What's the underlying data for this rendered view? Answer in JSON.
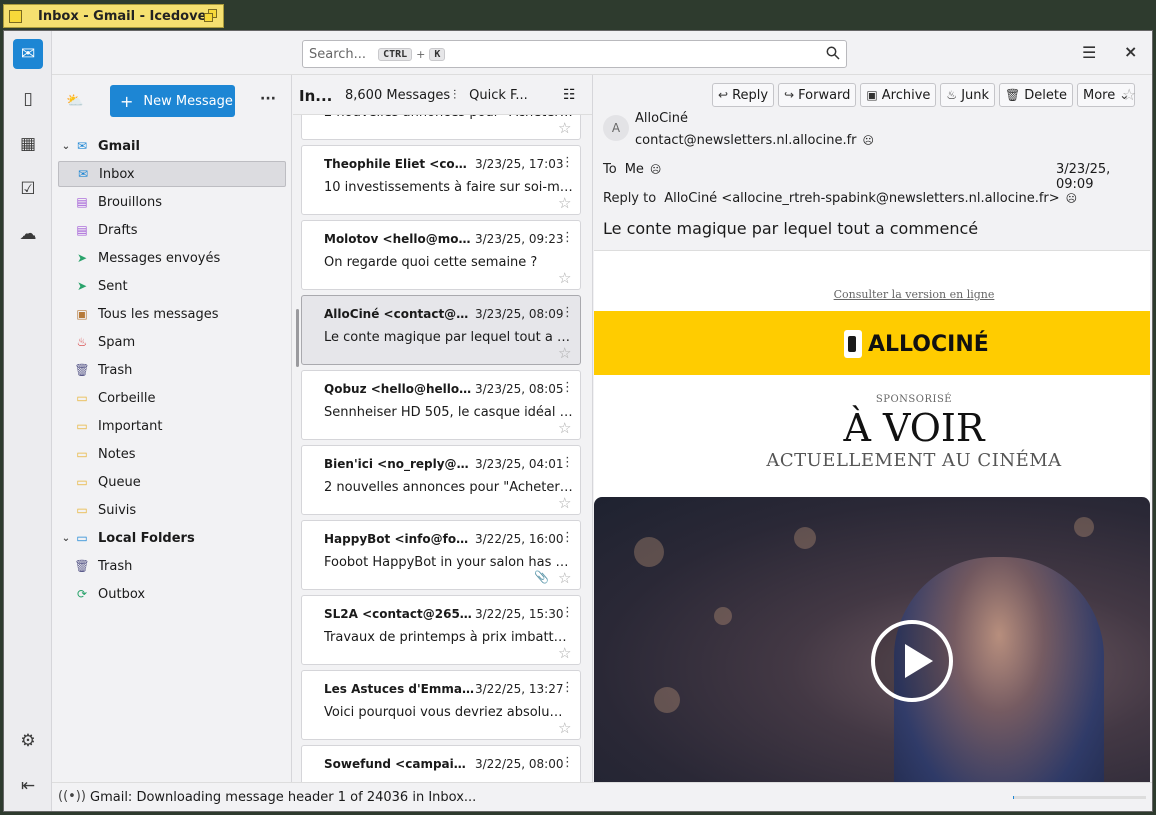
{
  "window": {
    "title": "Inbox - Gmail - Icedove"
  },
  "spaces": [
    {
      "name": "mail-icon",
      "glyph": "✉"
    },
    {
      "name": "address-book-icon",
      "glyph": "▯"
    },
    {
      "name": "calendar-icon",
      "glyph": "▦"
    },
    {
      "name": "tasks-icon",
      "glyph": "☑"
    },
    {
      "name": "chat-icon",
      "glyph": "☁"
    }
  ],
  "search": {
    "placeholder": "Search...",
    "shortcut_key1": "CTRL",
    "shortcut_plus": "+",
    "shortcut_key2": "K"
  },
  "folder_pane": {
    "new_message": "New Message",
    "accounts": [
      {
        "label": "Gmail"
      },
      {
        "label": "Local Folders"
      }
    ],
    "gmail_folders": [
      {
        "label": "Inbox",
        "icon": "inbox-icon",
        "glyph": "✉",
        "color": "#1d86d4"
      },
      {
        "label": "Brouillons",
        "icon": "draft-icon",
        "glyph": "▤",
        "color": "#a25ad6"
      },
      {
        "label": "Drafts",
        "icon": "draft-icon",
        "glyph": "▤",
        "color": "#a25ad6"
      },
      {
        "label": "Messages envoyés",
        "icon": "sent-icon",
        "glyph": "➤",
        "color": "#2aa36b"
      },
      {
        "label": "Sent",
        "icon": "sent-icon",
        "glyph": "➤",
        "color": "#2aa36b"
      },
      {
        "label": "Tous les messages",
        "icon": "archive-icon",
        "glyph": "▣",
        "color": "#b67a3a"
      },
      {
        "label": "Spam",
        "icon": "spam-icon",
        "glyph": "♨",
        "color": "#d63a3a"
      },
      {
        "label": "Trash",
        "icon": "trash-icon",
        "glyph": "🗑",
        "color": "#5a5a8a"
      },
      {
        "label": "Corbeille",
        "icon": "folder-icon",
        "glyph": "▭",
        "color": "#e8b53a"
      },
      {
        "label": "Important",
        "icon": "folder-icon",
        "glyph": "▭",
        "color": "#e8b53a"
      },
      {
        "label": "Notes",
        "icon": "folder-icon",
        "glyph": "▭",
        "color": "#e8b53a"
      },
      {
        "label": "Queue",
        "icon": "folder-icon",
        "glyph": "▭",
        "color": "#e8b53a"
      },
      {
        "label": "Suivis",
        "icon": "folder-icon",
        "glyph": "▭",
        "color": "#e8b53a"
      }
    ],
    "local_folders": [
      {
        "label": "Trash",
        "icon": "trash-icon",
        "glyph": "🗑",
        "color": "#5a5a8a"
      },
      {
        "label": "Outbox",
        "icon": "outbox-icon",
        "glyph": "⟳",
        "color": "#2aa36b"
      }
    ]
  },
  "message_list": {
    "folder_title": "In...",
    "count": "8,600 Messages",
    "quick_filter": "Quick F...",
    "messages": [
      {
        "sender": "",
        "date": "",
        "subject": "2 nouvelles annonces pour \"Acheter une...",
        "attachment": false,
        "selected": false
      },
      {
        "sender": "Theophile Eliet <conta...",
        "date": "3/23/25, 17:03",
        "subject": "10 investissements à faire sur soi-même ...",
        "attachment": false,
        "selected": false
      },
      {
        "sender": "Molotov <hello@molot...",
        "date": "3/23/25, 09:23",
        "subject": "On regarde quoi cette semaine ?",
        "attachment": false,
        "selected": false
      },
      {
        "sender": "AlloCiné <contact@ne...",
        "date": "3/23/25, 08:09",
        "subject": "Le conte magique par lequel tout a com...",
        "attachment": false,
        "selected": true
      },
      {
        "sender": "Qobuz <hello@hello.qo...",
        "date": "3/23/25, 08:05",
        "subject": "Sennheiser HD 505, le casque idéal pour ...",
        "attachment": false,
        "selected": false
      },
      {
        "sender": "Bien'ici <no_reply@bie...",
        "date": "3/23/25, 04:01",
        "subject": "2 nouvelles annonces pour \"Acheter une...",
        "attachment": false,
        "selected": false
      },
      {
        "sender": "HappyBot <info@foob...",
        "date": "3/22/25, 16:00",
        "subject": "Foobot HappyBot in your salon has a co...",
        "attachment": true,
        "selected": false
      },
      {
        "sender": "SL2A <contact@265301...",
        "date": "3/22/25, 15:30",
        "subject": "Travaux de printemps à prix imbattables !",
        "attachment": false,
        "selected": false
      },
      {
        "sender": "Les Astuces d'Emma <...",
        "date": "3/22/25, 13:27",
        "subject": "Voici pourquoi vous devriez absolument...",
        "attachment": false,
        "selected": false
      },
      {
        "sender": "Sowefund <campaigns...",
        "date": "3/22/25, 08:00",
        "subject": "",
        "attachment": false,
        "selected": false
      }
    ]
  },
  "reader": {
    "actions": {
      "reply": "Reply",
      "forward": "Forward",
      "archive": "Archive",
      "junk": "Junk",
      "delete": "Delete",
      "more": "More"
    },
    "avatar_initial": "A",
    "from_name": "AlloCiné",
    "from_address": "contact@newsletters.nl.allocine.fr",
    "to_label": "To",
    "to_value": "Me",
    "date": "3/23/25, 09:09",
    "reply_to_label": "Reply to",
    "reply_to_value": "AlloCiné <allocine_rtreh-spabink@newsletters.nl.allocine.fr>",
    "subject": "Le conte magique par lequel tout a commencé",
    "body": {
      "online_link": "Consulter la version en ligne",
      "brand": "ALLOCINÉ",
      "sponsored": "SPONSORISÉ",
      "headline": "À VOIR",
      "subheadline": "ACTUELLEMENT AU CINÉMA"
    }
  },
  "status": {
    "text": "Gmail: Downloading message header 1 of 24036 in Inbox...",
    "progress": 0.01
  }
}
